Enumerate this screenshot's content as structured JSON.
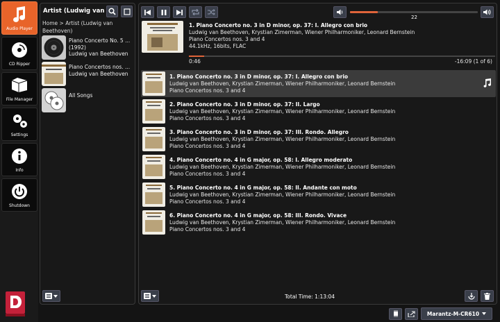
{
  "nav": [
    {
      "label": "Audio Player",
      "icon": "music-note-icon",
      "active": true
    },
    {
      "label": "CD Ripper",
      "icon": "disc-icon",
      "active": false
    },
    {
      "label": "File Manager",
      "icon": "folder-icon",
      "active": false
    },
    {
      "label": "Settings",
      "icon": "gears-icon",
      "active": false
    },
    {
      "label": "Info",
      "icon": "info-icon",
      "active": false
    },
    {
      "label": "Shutdown",
      "icon": "power-icon",
      "active": false
    }
  ],
  "browse": {
    "title": "Artist (Ludwig van",
    "breadcrumb": "Home > Artist (Ludwig van Beethoven)",
    "items": [
      {
        "line1": "Piano Concerto No. 5 ...",
        "line2": "(1992)",
        "line3": "Ludwig van Beethoven",
        "icon": "vinyl-record-icon"
      },
      {
        "line1": "Piano Concertos nos. ...",
        "line2": "Ludwig van Beethoven",
        "line3": "",
        "icon": "album-cover-icon"
      },
      {
        "line1": "All Songs",
        "line2": "",
        "line3": "",
        "icon": "cd-stack-icon"
      }
    ]
  },
  "player": {
    "volume": 22,
    "volume_fraction": 0.22,
    "progress_fraction": 0.05,
    "now_playing": {
      "title": "1. Piano Concerto no. 3 in D minor, op. 37: I. Allegro con brio",
      "artists": "Ludwig van Beethoven, Krystian Zimerman, Wiener Philharmoniker, Leonard Bernstein",
      "album": "Piano Concertos nos. 3 and 4",
      "format": "44.1kHz, 16bits, FLAC"
    },
    "elapsed": "0:46",
    "remaining": "-16:09 (1 of 6)"
  },
  "queue": [
    {
      "title": "1. Piano Concerto no. 3 in D minor, op. 37: I. Allegro con brio",
      "artists": "Ludwig van Beethoven, Krystian Zimerman, Wiener Philharmoniker, Leonard Bernstein",
      "album": "Piano Concertos nos. 3 and 4",
      "current": true
    },
    {
      "title": "2. Piano Concerto no. 3 in D minor, op. 37: II. Largo",
      "artists": "Ludwig van Beethoven, Krystian Zimerman, Wiener Philharmoniker, Leonard Bernstein",
      "album": "Piano Concertos nos. 3 and 4",
      "current": false
    },
    {
      "title": "3. Piano Concerto no. 3 in D minor, op. 37: III. Rondo. Allegro",
      "artists": "Ludwig van Beethoven, Krystian Zimerman, Wiener Philharmoniker, Leonard Bernstein",
      "album": "Piano Concertos nos. 3 and 4",
      "current": false
    },
    {
      "title": "4. Piano Concerto no. 4 in G major, op. 58: I. Allegro moderato",
      "artists": "Ludwig van Beethoven, Krystian Zimerman, Wiener Philharmoniker, Leonard Bernstein",
      "album": "Piano Concertos nos. 3 and 4",
      "current": false
    },
    {
      "title": "5. Piano Concerto no. 4 in G major, op. 58: II. Andante con moto",
      "artists": "Ludwig van Beethoven, Krystian Zimerman, Wiener Philharmoniker, Leonard Bernstein",
      "album": "Piano Concertos nos. 3 and 4",
      "current": false
    },
    {
      "title": "6. Piano Concerto no. 4 in G major, op. 58: III. Rondo. Vivace",
      "artists": "Ludwig van Beethoven, Krystian Zimerman, Wiener Philharmoniker, Leonard Bernstein",
      "album": "Piano Concertos nos. 3 and 4",
      "current": false
    }
  ],
  "total_time": "Total Time: 1:13:04",
  "device": "Marantz-M-CR610",
  "colors": {
    "accent": "#e8642a",
    "panel": "#181818",
    "button": "#3a3f4a"
  }
}
